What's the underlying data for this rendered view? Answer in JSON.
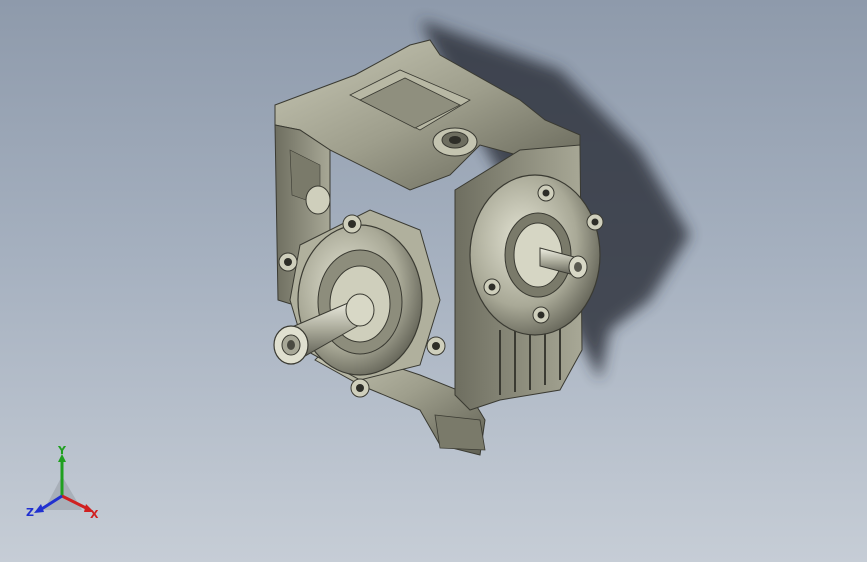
{
  "viewport": {
    "background_top": "#8e9aab",
    "background_bottom": "#c6cdd6"
  },
  "model": {
    "icon": "worm-gearbox-3d-model",
    "body_color": "#9a9a88",
    "shadow_color": "#2c2f38"
  },
  "triad": {
    "icon": "coordinate-triad-icon",
    "x_label": "X",
    "y_label": "Y",
    "z_label": "Z",
    "x_color": "#d02020",
    "y_color": "#20a020",
    "z_color": "#2030d0"
  }
}
